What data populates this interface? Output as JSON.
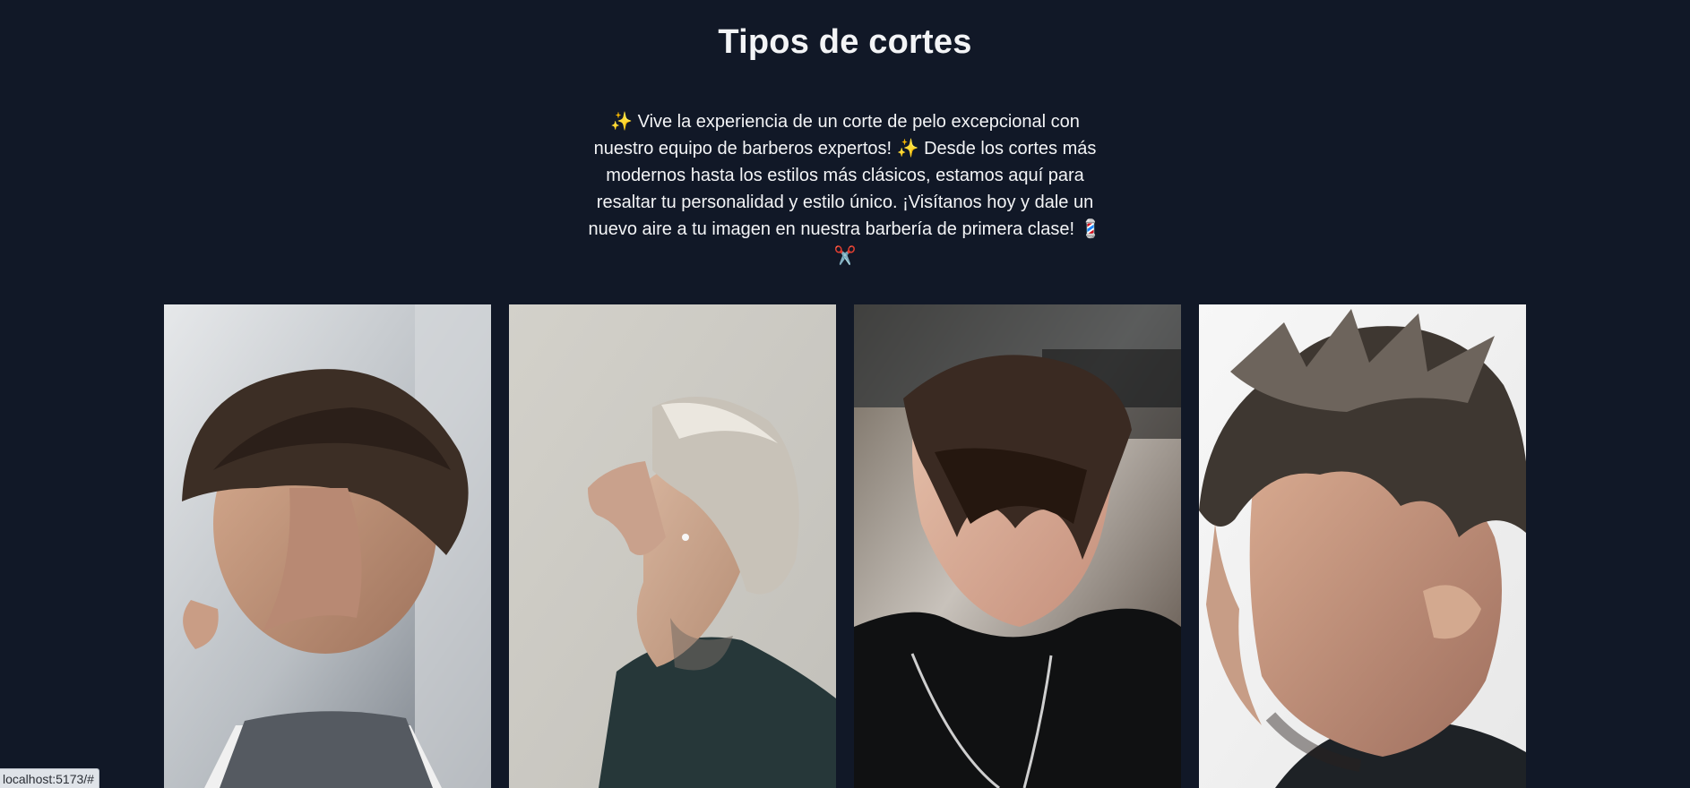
{
  "section": {
    "title": "Tipos de cortes",
    "description": "✨ Vive la experiencia de un corte de pelo excepcional con nuestro equipo de barberos expertos! ✨ Desde los cortes más modernos hasta los estilos más clásicos, estamos aquí para resaltar tu personalidad y estilo único. ¡Visítanos hoy y dale un nuevo aire a tu imagen en nuestra barbería de primera clase! 💈✂️"
  },
  "gallery": {
    "images": [
      {
        "icon": "haircut-photo-curly-fade"
      },
      {
        "icon": "haircut-photo-blond-side-profile"
      },
      {
        "icon": "haircut-photo-french-crop"
      },
      {
        "icon": "haircut-photo-textured-fringe"
      }
    ]
  },
  "status_bar": {
    "url": "localhost:5173/#"
  },
  "colors": {
    "background": "#111827",
    "text": "#f3f4f6"
  }
}
